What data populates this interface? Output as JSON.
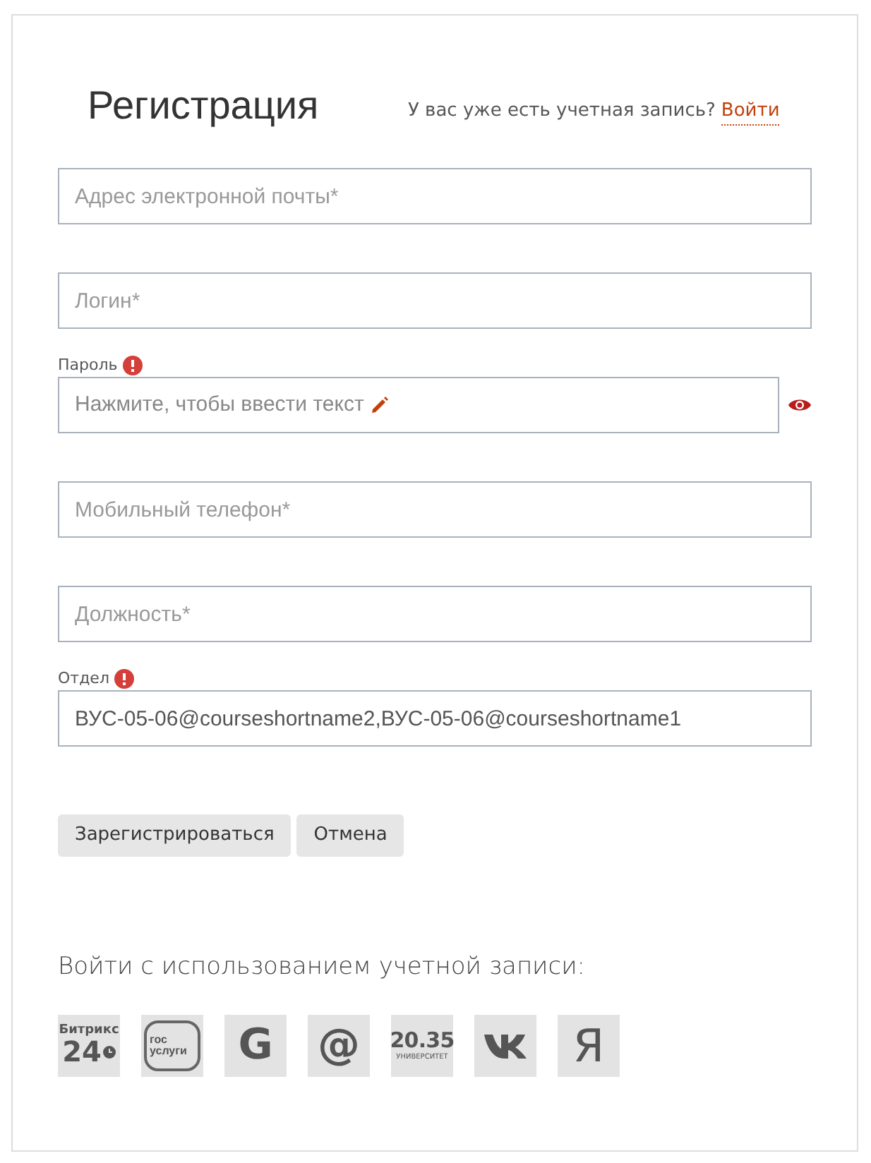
{
  "title": "Регистрация",
  "login_prompt": {
    "text": "У вас уже есть учетная запись?",
    "link": "Войти"
  },
  "fields": [
    {
      "kind": "input",
      "placeholder": "Адрес электронной почты*"
    },
    {
      "kind": "input",
      "placeholder": "Логин*"
    },
    {
      "kind": "click_to_edit",
      "label": "Пароль",
      "error": true,
      "text": "Нажмите, чтобы ввести текст",
      "reveal": true
    },
    {
      "kind": "input",
      "placeholder": "Мобильный телефон*"
    },
    {
      "kind": "input",
      "placeholder": "Должность*"
    },
    {
      "kind": "input",
      "label": "Отдел",
      "error": true,
      "value": "ВУС-05-06@courseshortname2,ВУС-05-06@courseshortname1"
    }
  ],
  "buttons": [
    "Зарегистрироваться",
    "Отмена"
  ],
  "social": {
    "heading": "Войти с использованием учетной записи:",
    "providers": [
      {
        "kind": "bitrix",
        "lines": [
          "Битрикс",
          "24"
        ]
      },
      {
        "kind": "gosuslugi",
        "lines": [
          "гос",
          "услуги"
        ]
      },
      {
        "kind": "letter",
        "lines": [
          "G"
        ]
      },
      {
        "kind": "letter",
        "lines": [
          "@"
        ]
      },
      {
        "kind": "university",
        "lines": [
          "20.35",
          "УНИВЕРСИТЕТ"
        ]
      },
      {
        "kind": "vk"
      },
      {
        "kind": "thin_letter",
        "lines": [
          "Я"
        ]
      }
    ]
  }
}
